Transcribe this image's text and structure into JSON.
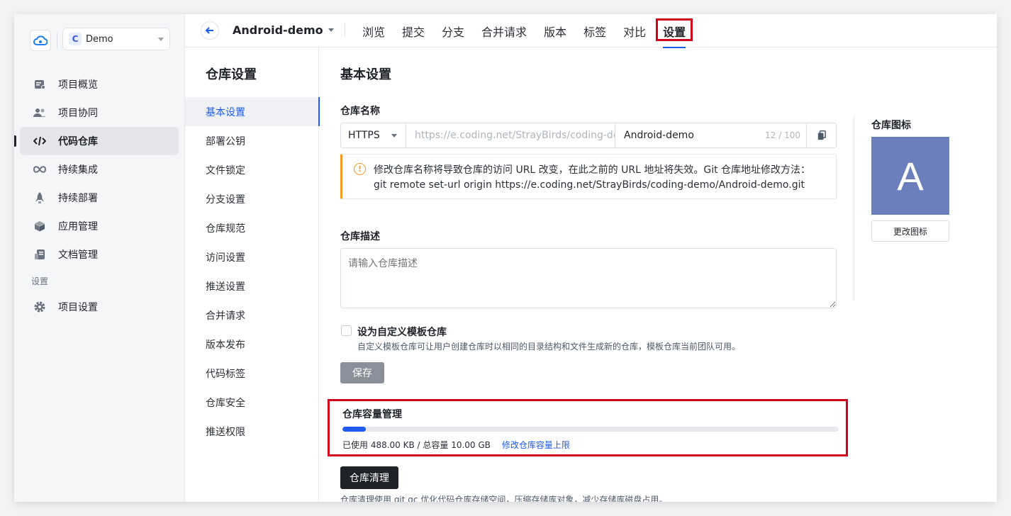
{
  "sidebar": {
    "project": {
      "badge": "C",
      "name": "Demo"
    },
    "items": [
      {
        "label": "项目概览",
        "icon": "overview-icon"
      },
      {
        "label": "项目协同",
        "icon": "users-icon"
      },
      {
        "label": "代码仓库",
        "icon": "code-icon"
      },
      {
        "label": "持续集成",
        "icon": "infinity-icon"
      },
      {
        "label": "持续部署",
        "icon": "rocket-icon"
      },
      {
        "label": "应用管理",
        "icon": "cube-icon"
      },
      {
        "label": "文档管理",
        "icon": "document-icon"
      }
    ],
    "section_label": "设置",
    "settings_item": {
      "label": "项目设置",
      "icon": "gear-icon"
    }
  },
  "header": {
    "repo_name": "Android-demo",
    "tabs": [
      "浏览",
      "提交",
      "分支",
      "合并请求",
      "版本",
      "标签",
      "对比",
      "设置"
    ],
    "active_tab": "设置"
  },
  "subnav": {
    "title": "仓库设置",
    "items": [
      "基本设置",
      "部署公钥",
      "文件锁定",
      "分支设置",
      "仓库规范",
      "访问设置",
      "推送设置",
      "合并请求",
      "版本发布",
      "代码标签",
      "仓库安全",
      "推送权限"
    ]
  },
  "main": {
    "title": "基本设置",
    "repo_name_label": "仓库名称",
    "protocol": "HTTPS",
    "url_prefix": "https://e.coding.net/StrayBirds/coding-de...",
    "name_value": "Android-demo",
    "name_count": "12 / 100",
    "warning_line1": "修改仓库名称将导致仓库的访问 URL 改变，在此之前的 URL 地址将失效。Git 仓库地址修改方法：",
    "warning_line2": "git remote set-url origin https://e.coding.net/StrayBirds/coding-demo/Android-demo.git",
    "desc_label": "仓库描述",
    "desc_placeholder": "请输入仓库描述",
    "template_label": "设为自定义模板仓库",
    "template_sub": "自定义模板仓库可让用户创建仓库时以相同的目录结构和文件生成新的仓库，模板仓库当前团队可用。",
    "save_label": "保存",
    "capacity": {
      "title": "仓库容量管理",
      "used_fraction": 0.0477,
      "usage_text": "已使用 488.00 KB / 总容量 10.00 GB",
      "link": "修改仓库容量上限"
    },
    "clean_label": "仓库清理",
    "clean_note": "仓库清理使用 git gc 优化代码仓库存储空间，压缩存储库对象，减少存储库磁盘占用。",
    "icon_label": "仓库图标",
    "icon_letter": "A",
    "change_icon_label": "更改图标"
  },
  "colors": {
    "accent": "#1e5bf0",
    "highlight": "#d0021b",
    "repo_icon_bg": "#6b7fbd"
  }
}
